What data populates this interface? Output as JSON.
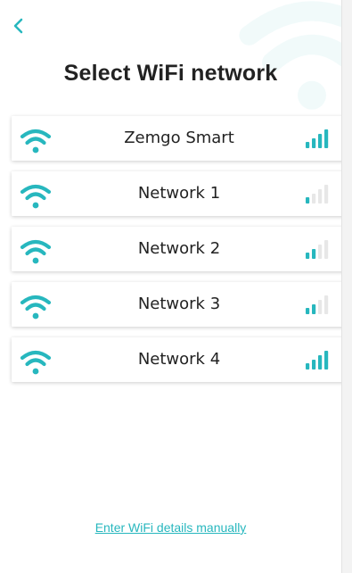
{
  "header": {
    "back_icon": "chevron-left-icon",
    "title": "Select WiFi network"
  },
  "colors": {
    "accent": "#27b7be",
    "signal_inactive": "#e7e7e7",
    "text": "#222222"
  },
  "networks": [
    {
      "name": "Zemgo Smart",
      "signal_bars": 4
    },
    {
      "name": "Network 1",
      "signal_bars": 1
    },
    {
      "name": "Network 2",
      "signal_bars": 2
    },
    {
      "name": "Network 3",
      "signal_bars": 2
    },
    {
      "name": "Network 4",
      "signal_bars": 4
    }
  ],
  "footer": {
    "manual_link": "Enter WiFi details manually"
  }
}
